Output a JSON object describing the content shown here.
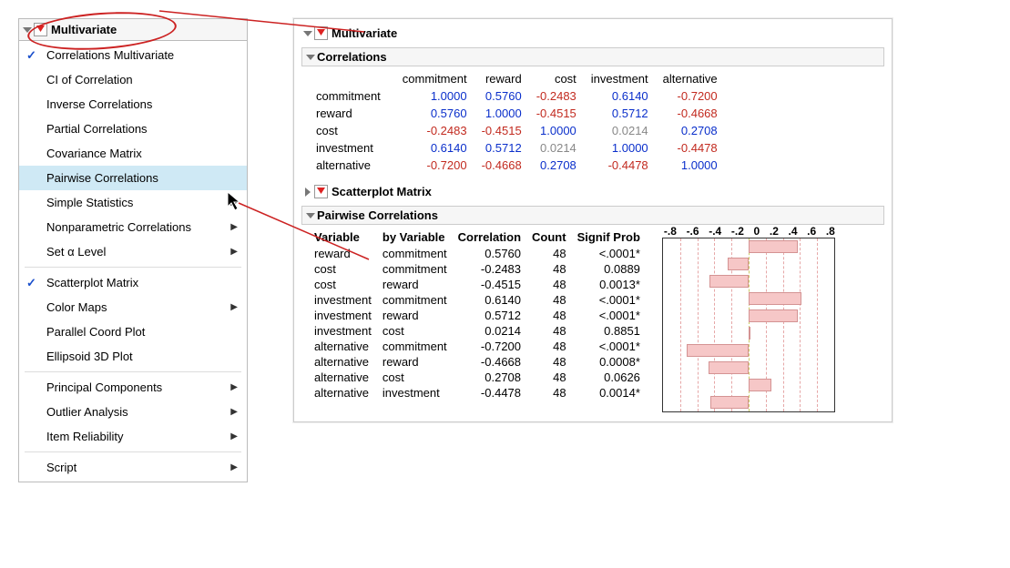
{
  "menu": {
    "title": "Multivariate",
    "items": [
      {
        "label": "Correlations Multivariate",
        "checked": true,
        "submenu": false,
        "highlight": false
      },
      {
        "label": "CI of Correlation",
        "checked": false,
        "submenu": false,
        "highlight": false
      },
      {
        "label": "Inverse Correlations",
        "checked": false,
        "submenu": false,
        "highlight": false
      },
      {
        "label": "Partial Correlations",
        "checked": false,
        "submenu": false,
        "highlight": false
      },
      {
        "label": "Covariance Matrix",
        "checked": false,
        "submenu": false,
        "highlight": false
      },
      {
        "label": "Pairwise Correlations",
        "checked": false,
        "submenu": false,
        "highlight": true
      },
      {
        "label": "Simple Statistics",
        "checked": false,
        "submenu": true,
        "highlight": false
      },
      {
        "label": "Nonparametric Correlations",
        "checked": false,
        "submenu": true,
        "highlight": false
      },
      {
        "label": "Set α Level",
        "checked": false,
        "submenu": true,
        "highlight": false,
        "sep_after": true
      },
      {
        "label": "Scatterplot Matrix",
        "checked": true,
        "submenu": false,
        "highlight": false
      },
      {
        "label": "Color Maps",
        "checked": false,
        "submenu": true,
        "highlight": false
      },
      {
        "label": "Parallel Coord Plot",
        "checked": false,
        "submenu": false,
        "highlight": false
      },
      {
        "label": "Ellipsoid 3D Plot",
        "checked": false,
        "submenu": false,
        "highlight": false,
        "sep_after": true
      },
      {
        "label": "Principal Components",
        "checked": false,
        "submenu": true,
        "highlight": false
      },
      {
        "label": "Outlier Analysis",
        "checked": false,
        "submenu": true,
        "highlight": false
      },
      {
        "label": "Item Reliability",
        "checked": false,
        "submenu": true,
        "highlight": false,
        "sep_after": true
      },
      {
        "label": "Script",
        "checked": false,
        "submenu": true,
        "highlight": false
      }
    ]
  },
  "output": {
    "title": "Multivariate",
    "corr_section": "Correlations",
    "scatter_section": "Scatterplot Matrix",
    "pair_section": "Pairwise Correlations",
    "vars": [
      "commitment",
      "reward",
      "cost",
      "investment",
      "alternative"
    ],
    "corr": {
      "commitment": {
        "commitment": 1.0,
        "reward": 0.576,
        "cost": -0.2483,
        "investment": 0.614,
        "alternative": -0.72
      },
      "reward": {
        "commitment": 0.576,
        "reward": 1.0,
        "cost": -0.4515,
        "investment": 0.5712,
        "alternative": -0.4668
      },
      "cost": {
        "commitment": -0.2483,
        "reward": -0.4515,
        "cost": 1.0,
        "investment": 0.0214,
        "alternative": 0.2708
      },
      "investment": {
        "commitment": 0.614,
        "reward": 0.5712,
        "cost": 0.0214,
        "investment": 1.0,
        "alternative": -0.4478
      },
      "alternative": {
        "commitment": -0.72,
        "reward": -0.4668,
        "cost": 0.2708,
        "investment": -0.4478,
        "alternative": 1.0
      }
    },
    "pair_headers": [
      "Variable",
      "by Variable",
      "Correlation",
      "Count",
      "Signif Prob"
    ],
    "pairwise": [
      {
        "v": "reward",
        "by": "commitment",
        "r": 0.576,
        "n": 48,
        "p": "<.0001*"
      },
      {
        "v": "cost",
        "by": "commitment",
        "r": -0.2483,
        "n": 48,
        "p": "0.0889"
      },
      {
        "v": "cost",
        "by": "reward",
        "r": -0.4515,
        "n": 48,
        "p": "0.0013*"
      },
      {
        "v": "investment",
        "by": "commitment",
        "r": 0.614,
        "n": 48,
        "p": "<.0001*"
      },
      {
        "v": "investment",
        "by": "reward",
        "r": 0.5712,
        "n": 48,
        "p": "<.0001*"
      },
      {
        "v": "investment",
        "by": "cost",
        "r": 0.0214,
        "n": 48,
        "p": "0.8851"
      },
      {
        "v": "alternative",
        "by": "commitment",
        "r": -0.72,
        "n": 48,
        "p": "<.0001*"
      },
      {
        "v": "alternative",
        "by": "reward",
        "r": -0.4668,
        "n": 48,
        "p": "0.0008*"
      },
      {
        "v": "alternative",
        "by": "cost",
        "r": 0.2708,
        "n": 48,
        "p": "0.0626"
      },
      {
        "v": "alternative",
        "by": "investment",
        "r": -0.4478,
        "n": 48,
        "p": "0.0014*"
      }
    ],
    "bar_ticks": [
      "-.8",
      "-.6",
      "-.4",
      "-.2",
      "0",
      ".2",
      ".4",
      ".6",
      ".8"
    ]
  },
  "chart_data": {
    "type": "bar",
    "orientation": "horizontal",
    "title": "Pairwise Correlations",
    "xlabel": "Correlation",
    "xlim": [
      -1,
      1
    ],
    "xticks": [
      -0.8,
      -0.6,
      -0.4,
      -0.2,
      0,
      0.2,
      0.4,
      0.6,
      0.8
    ],
    "categories": [
      "reward × commitment",
      "cost × commitment",
      "cost × reward",
      "investment × commitment",
      "investment × reward",
      "investment × cost",
      "alternative × commitment",
      "alternative × reward",
      "alternative × cost",
      "alternative × investment"
    ],
    "values": [
      0.576,
      -0.2483,
      -0.4515,
      0.614,
      0.5712,
      0.0214,
      -0.72,
      -0.4668,
      0.2708,
      -0.4478
    ]
  }
}
